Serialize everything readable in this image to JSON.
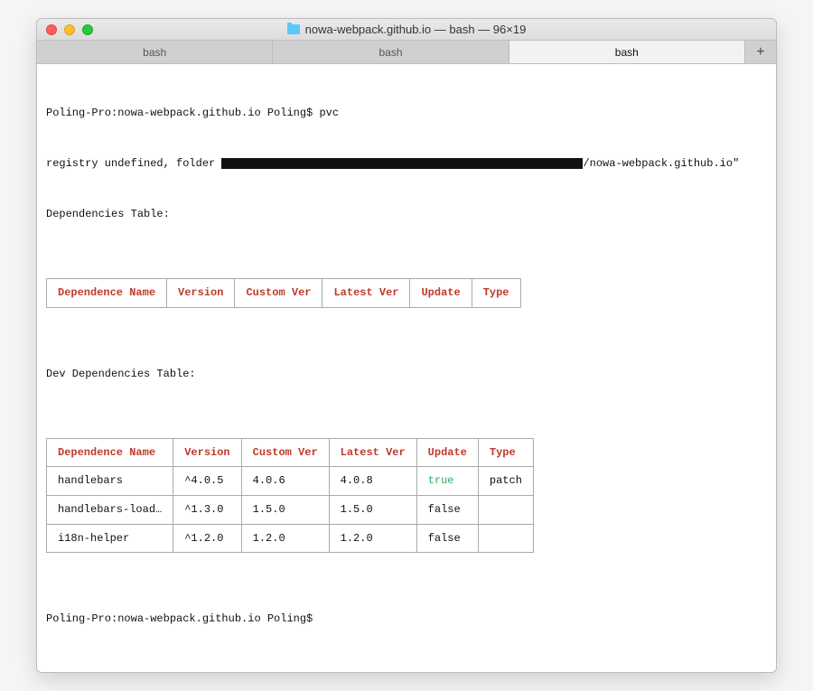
{
  "window": {
    "title": "nowa-webpack.github.io — bash — 96×19"
  },
  "tabs": {
    "items": [
      "bash",
      "bash",
      "bash"
    ],
    "active_index": 2,
    "plus": "+"
  },
  "terminal": {
    "prompt1": "Poling-Pro:nowa-webpack.github.io Poling$ ",
    "command1": "pvc",
    "registry_line_prefix": "registry undefined, folder ",
    "registry_line_suffix": "/nowa-webpack.github.io\"",
    "deps_label": "Dependencies Table:",
    "dev_deps_label": "Dev Dependencies Table:",
    "prompt2": "Poling-Pro:nowa-webpack.github.io Poling$ "
  },
  "table": {
    "headers": [
      "Dependence Name",
      "Version",
      "Custom Ver",
      "Latest Ver",
      "Update",
      "Type"
    ]
  },
  "dev_table": {
    "rows": [
      {
        "name": "handlebars",
        "version": "^4.0.5",
        "custom": "4.0.6",
        "latest": "4.0.8",
        "update": "true",
        "update_class": "green",
        "type": "patch"
      },
      {
        "name": "handlebars-load…",
        "version": "^1.3.0",
        "custom": "1.5.0",
        "latest": "1.5.0",
        "update": "false",
        "update_class": "",
        "type": ""
      },
      {
        "name": "i18n-helper",
        "version": "^1.2.0",
        "custom": "1.2.0",
        "latest": "1.2.0",
        "update": "false",
        "update_class": "",
        "type": ""
      }
    ]
  }
}
